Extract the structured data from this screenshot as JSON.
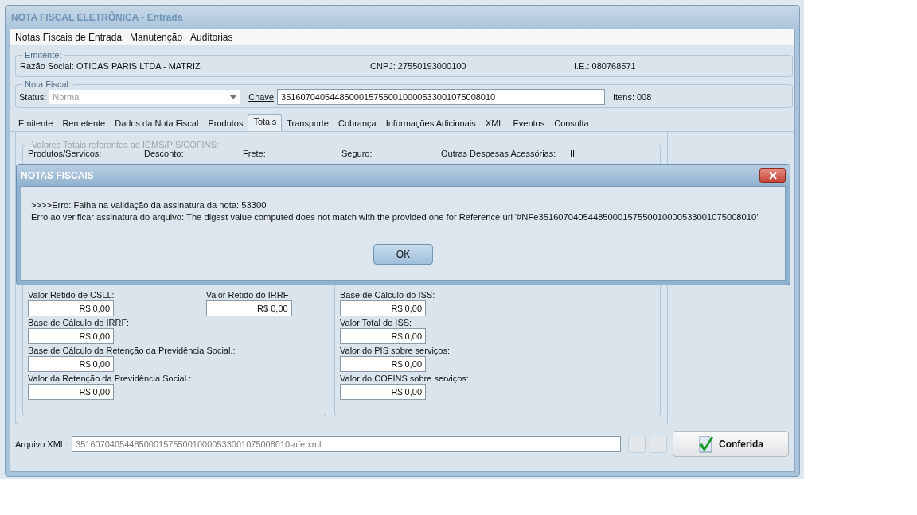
{
  "window": {
    "title": "NOTA FISCAL ELETRÔNICA - Entrada"
  },
  "menu": [
    "Notas Fiscais de Entrada",
    "Manutenção",
    "Auditorias"
  ],
  "emitente": {
    "legend": "Emitente:",
    "razao_social": "Razão Social: OTICAS PARIS LTDA - MATRIZ",
    "cnpj": "CNPJ: 27550193000100",
    "ie": "I.E.: 080768571"
  },
  "nota_fiscal": {
    "legend": "Nota Fiscal:",
    "status_label": "Status:",
    "status_value": "Normal",
    "status_disabled": true,
    "chave_label": "Chave",
    "chave_value": "35160704054485000157550010000533001075008010",
    "itens": "Itens: 008"
  },
  "tabs": [
    {
      "label": "Emitente",
      "selected": false
    },
    {
      "label": "Remetente",
      "selected": false
    },
    {
      "label": "Dados da Nota Fiscal",
      "selected": false
    },
    {
      "label": "Produtos",
      "selected": false
    },
    {
      "label": "Totais",
      "selected": true
    },
    {
      "label": "Transporte",
      "selected": false
    },
    {
      "label": "Cobrança",
      "selected": false
    },
    {
      "label": "Informações Adicionais",
      "selected": false
    },
    {
      "label": "XML",
      "selected": false
    },
    {
      "label": "Eventos",
      "selected": false
    },
    {
      "label": "Consulta",
      "selected": false
    }
  ],
  "totais": {
    "group_title": "Valores Totais referentes ao ICMS/PIS/COFINS:",
    "columns": [
      "Produtos/Servicos:",
      "Desconto:",
      "Frete:",
      "Seguro:",
      "Outras Despesas Acessórias:",
      "II:"
    ],
    "left_rows": [
      [
        {
          "label": "Valor Retido de CSLL:",
          "value": "R$ 0,00"
        },
        {
          "label": "Valor Retido do IRRF",
          "value": "R$ 0,00"
        }
      ],
      [
        {
          "label": "Base de Cálculo do IRRF:",
          "value": "R$ 0,00"
        }
      ],
      [
        {
          "label": "Base de Cálculo da Retenção da Previdência Social.:",
          "value": "R$ 0,00"
        }
      ],
      [
        {
          "label": "Valor da Retenção da Previdência Social.:",
          "value": "R$ 0,00"
        }
      ]
    ],
    "right_fields": [
      {
        "label": "Base de Cálculo do ISS:",
        "value": "R$ 0,00"
      },
      {
        "label": "Valor Total do ISS:",
        "value": "R$ 0,00"
      },
      {
        "label": "Valor do PIS sobre serviços:",
        "value": "R$ 0,00"
      },
      {
        "label": "Valor do COFINS sobre serviços:",
        "value": "R$ 0,00"
      }
    ]
  },
  "arquivo": {
    "label": "Arquivo XML:",
    "disabled": true,
    "value": "35160704054485000157550010000533001075008010-nfe.xml"
  },
  "conferida_button": "Conferida",
  "dialog": {
    "title": "NOTAS FISCAIS",
    "lines": [
      ">>>>Erro: Falha na validação da assinatura da nota: 53300",
      "Erro ao verificar assinatura do arquivo: The digest value computed does not match with the provided one for Reference uri '#NFe35160704054485000157550010000533001075008010'"
    ],
    "ok": "OK"
  }
}
